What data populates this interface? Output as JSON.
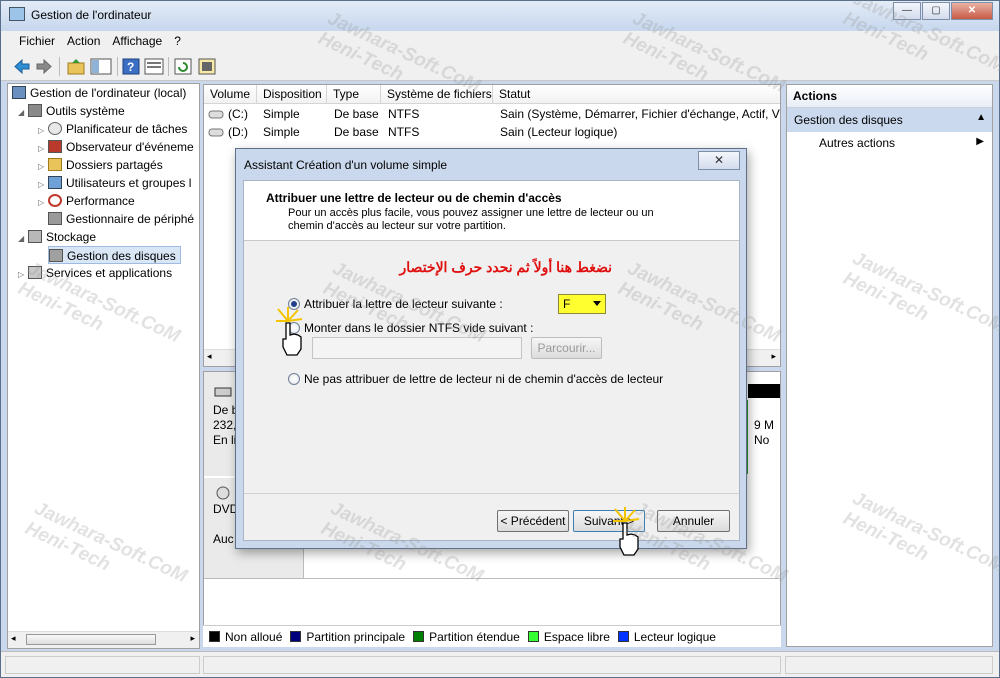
{
  "window": {
    "title": "Gestion de l'ordinateur",
    "min": "—",
    "max": "▢",
    "close": "✕"
  },
  "menu": [
    "Fichier",
    "Action",
    "Affichage",
    "?"
  ],
  "tree": {
    "root": "Gestion de l'ordinateur (local)",
    "system_tools": "Outils système",
    "items": [
      "Planificateur de tâches",
      "Observateur d'événeme",
      "Dossiers partagés",
      "Utilisateurs et groupes l",
      "Performance",
      "Gestionnaire de périphé"
    ],
    "storage": "Stockage",
    "disk_mgmt": "Gestion des disques",
    "services": "Services et applications"
  },
  "volumes": {
    "headers": [
      "Volume",
      "Disposition",
      "Type",
      "Système de fichiers",
      "Statut"
    ],
    "rows": [
      {
        "volume": "(C:)",
        "layout": "Simple",
        "type": "De base",
        "fs": "NTFS",
        "status": "Sain (Système, Démarrer, Fichier d'échange, Actif, Vid"
      },
      {
        "volume": "(D:)",
        "layout": "Simple",
        "type": "De base",
        "fs": "NTFS",
        "status": "Sain (Lecteur logique)"
      }
    ]
  },
  "disk_panel": {
    "disk0_line1": "De b",
    "disk0_line2": "232,",
    "disk0_line3": "En li",
    "dvd_label": "DVD",
    "dvd_status": "Auc",
    "right_line1": "9 M",
    "right_line2": "No"
  },
  "legend": [
    {
      "label": "Non alloué",
      "color": "#000000"
    },
    {
      "label": "Partition principale",
      "color": "#00007c"
    },
    {
      "label": "Partition étendue",
      "color": "#008000"
    },
    {
      "label": "Espace libre",
      "color": "#33ff33"
    },
    {
      "label": "Lecteur logique",
      "color": "#0033ff"
    }
  ],
  "actions": {
    "header": "Actions",
    "section": "Gestion des disques",
    "more": "Autres actions"
  },
  "dialog": {
    "title": "Assistant Création d'un volume simple",
    "close": "✕",
    "heading": "Attribuer une lettre de lecteur ou de chemin d'accès",
    "description": "Pour un accès plus facile, vous pouvez assigner une lettre de lecteur ou un chemin d'accès au lecteur sur votre partition.",
    "annotation": "نضغط هنا أولاً ثم نحدد حرف الإختصار",
    "option1": "Attribuer la lettre de lecteur suivante :",
    "drive_letter": "F",
    "option2": "Monter dans le dossier NTFS vide suivant :",
    "browse": "Parcourir...",
    "option3": "Ne pas attribuer de lettre de lecteur ni de chemin d'accès de lecteur",
    "back": "< Précédent",
    "next": "Suivant >",
    "cancel": "Annuler"
  },
  "watermarks": [
    "Jawhara-Soft.CoM",
    "Heni-Tech"
  ]
}
